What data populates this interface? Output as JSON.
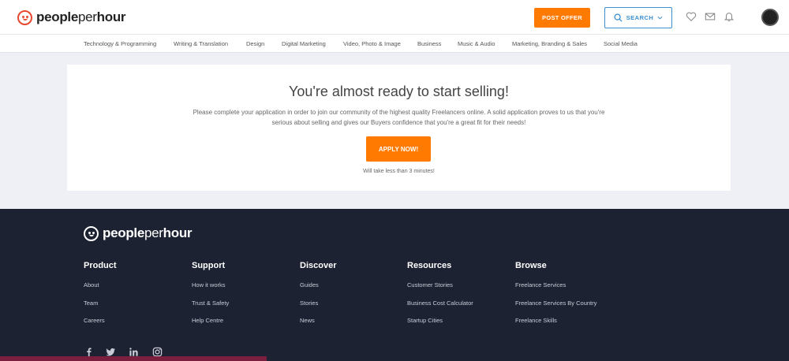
{
  "header": {
    "logo_main": "people",
    "logo_per": "per",
    "logo_hour": "hour",
    "post_offer_label": "POST OFFER",
    "search_label": "SEARCH",
    "accent_color": "#ff7a00",
    "search_color": "#3a8fd0"
  },
  "categories": [
    "Technology & Programming",
    "Writing & Translation",
    "Design",
    "Digital Marketing",
    "Video, Photo & Image",
    "Business",
    "Music & Audio",
    "Marketing, Branding & Sales",
    "Social Media"
  ],
  "main": {
    "title": "You're almost ready to start selling!",
    "description": "Please complete your application in order to join our community of the highest quality Freelancers online. A solid application proves to us that you're serious about selling and gives our Buyers confidence that you're a great fit for their needs!",
    "apply_label": "APPLY NOW!",
    "note": "Will take less than 3 minutes!"
  },
  "footer": {
    "logo_main": "people",
    "logo_per": "per",
    "logo_hour": "hour",
    "columns": [
      {
        "title": "Product",
        "links": [
          "About",
          "Team",
          "Careers"
        ]
      },
      {
        "title": "Support",
        "links": [
          "How it works",
          "Trust & Safety",
          "Help Centre"
        ]
      },
      {
        "title": "Discover",
        "links": [
          "Guides",
          "Stories",
          "News"
        ]
      },
      {
        "title": "Resources",
        "links": [
          "Customer Stories",
          "Business Cost Calculator",
          "Startup Cities"
        ]
      },
      {
        "title": "Browse",
        "links": [
          "Freelance Services",
          "Freelance Services By Country",
          "Freelance Skills"
        ]
      }
    ],
    "background_color": "#1d2233"
  }
}
